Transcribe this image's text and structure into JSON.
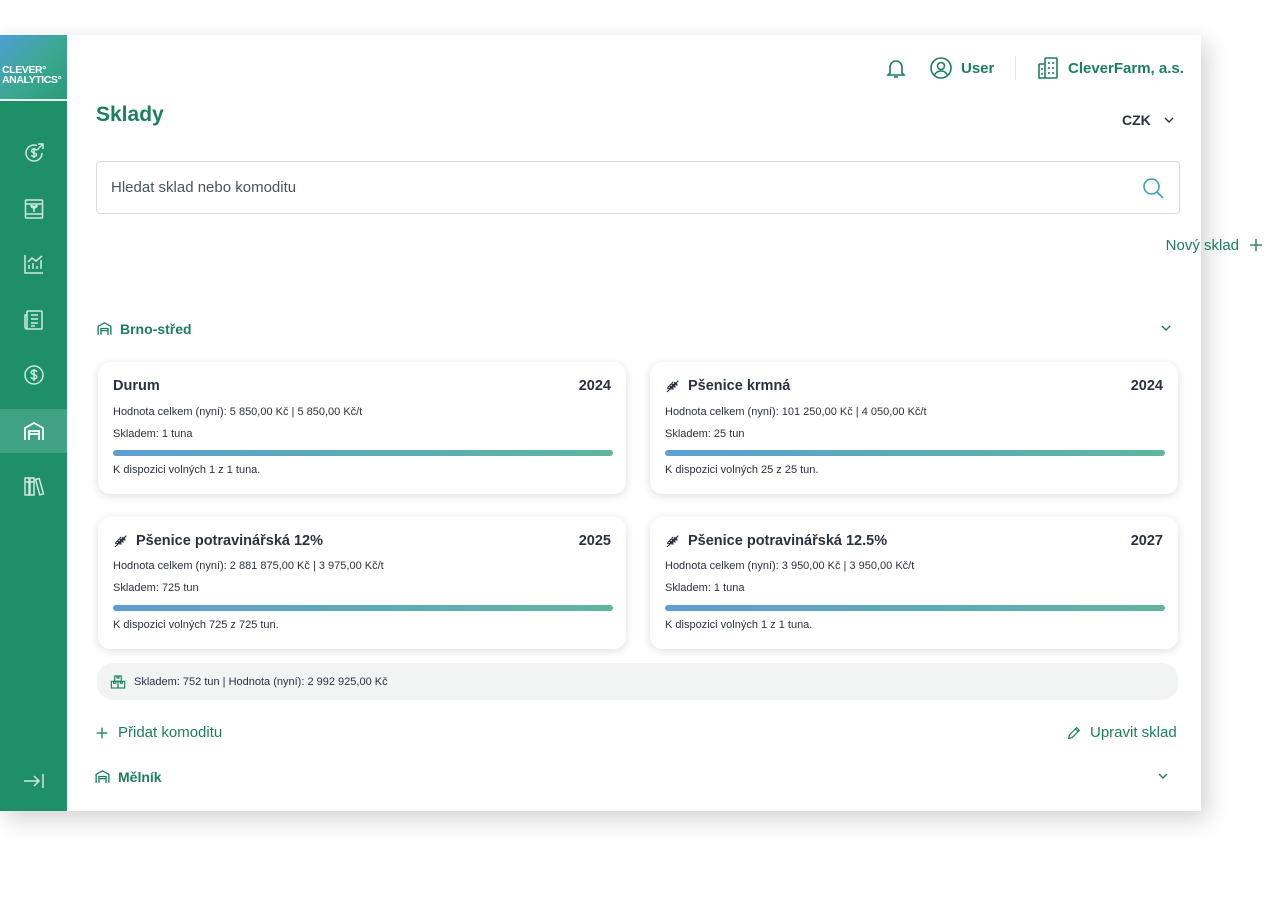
{
  "brand": {
    "logo_line1": "CLEVER°",
    "logo_line2": "ANALYTICS°"
  },
  "sidebar": {
    "items": [
      {
        "icon": "money-growth-icon",
        "active": false
      },
      {
        "icon": "seedling-box-icon",
        "active": false
      },
      {
        "icon": "bar-chart-icon",
        "active": false
      },
      {
        "icon": "document-list-icon",
        "active": false
      },
      {
        "icon": "dollar-coin-icon",
        "active": false
      },
      {
        "icon": "warehouse-icon",
        "active": true
      },
      {
        "icon": "library-icon",
        "active": false
      }
    ],
    "collapse_icon": "collapse-arrow-icon"
  },
  "header": {
    "user_label": "User",
    "company_label": "CleverFarm, a.s."
  },
  "page": {
    "title": "Sklady",
    "currency": "CZK",
    "search_placeholder": "Hledat sklad nebo komoditu",
    "new_store_label": "Nový sklad"
  },
  "warehouses": [
    {
      "name": "Brno-střed",
      "cards": [
        {
          "title": "Durum",
          "year": "2024",
          "has_icon": false,
          "value_line": "Hodnota celkem (nyní): 5 850,00 Kč | 5 850,00 Kč/t",
          "stock_line": "Skladem: 1 tuna",
          "available_line": "K dispozici volných 1 z 1 tuna.",
          "available_fraction": 1.0
        },
        {
          "title": "Pšenice krmná",
          "year": "2024",
          "has_icon": true,
          "value_line": "Hodnota celkem (nyní): 101 250,00 Kč | 4 050,00 Kč/t",
          "stock_line": "Skladem: 25 tun",
          "available_line": "K dispozici volných 25 z 25 tun.",
          "available_fraction": 1.0
        },
        {
          "title": "Pšenice potravinářská 12%",
          "year": "2025",
          "has_icon": true,
          "value_line": "Hodnota celkem (nyní): 2 881 875,00 Kč | 3 975,00 Kč/t",
          "stock_line": "Skladem: 725 tun",
          "available_line": "K dispozici volných 725 z 725 tun.",
          "available_fraction": 1.0
        },
        {
          "title": "Pšenice potravinářská 12.5%",
          "year": "2027",
          "has_icon": true,
          "value_line": "Hodnota celkem (nyní): 3 950,00 Kč | 3 950,00 Kč/t",
          "stock_line": "Skladem: 1 tuna",
          "available_line": "K dispozici volných 1 z 1 tuna.",
          "available_fraction": 1.0
        }
      ],
      "summary": "Skladem: 752 tun | Hodnota (nyní): 2 992 925,00 Kč",
      "add_label": "Přidat komoditu",
      "edit_label": "Upravit sklad"
    },
    {
      "name": "Mělník"
    }
  ],
  "colors": {
    "brand_green": "#1b7f5d",
    "sidebar": "#1f8f6a",
    "sidebar_active": "#3fa283"
  }
}
